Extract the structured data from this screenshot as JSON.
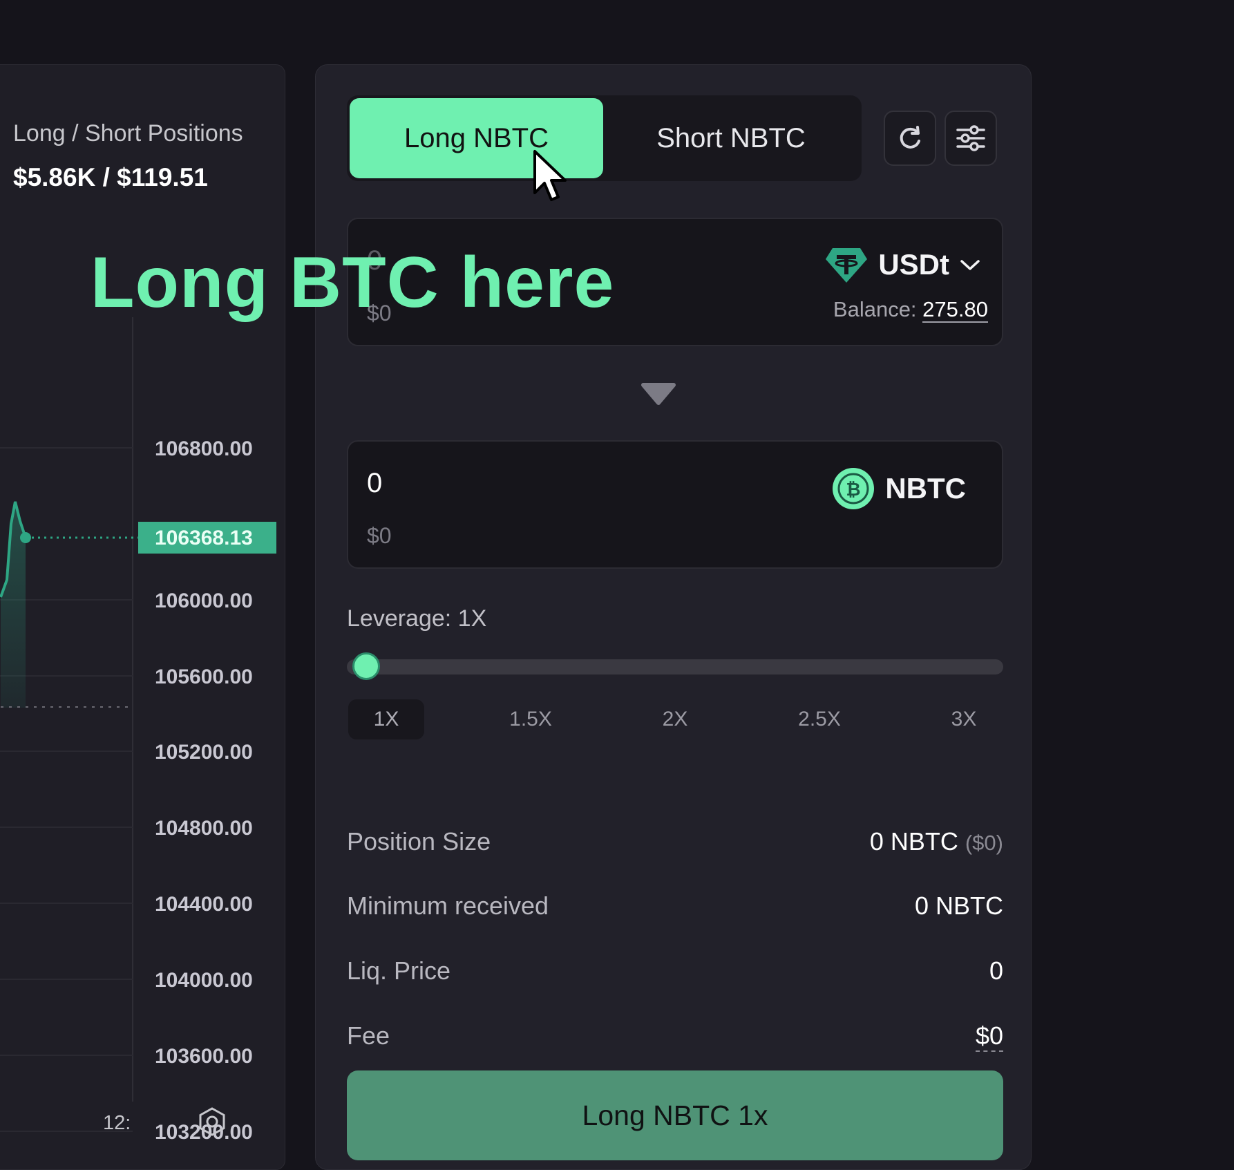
{
  "chart_panel": {
    "positions_label": "Long / Short Positions",
    "positions_value": "$5.86K / $119.51",
    "price_ticks": [
      "106800.00",
      "106000.00",
      "105600.00",
      "105200.00",
      "104800.00",
      "104400.00",
      "104000.00",
      "103600.00",
      "103200.00"
    ],
    "current_price": "106368.13",
    "time_label": "12:",
    "accent_color": "#2ea684"
  },
  "trade": {
    "tabs": {
      "long_label": "Long NBTC",
      "short_label": "Short NBTC",
      "active": "long"
    },
    "pay": {
      "amount": "0",
      "usd": "$0",
      "token": "USDt",
      "balance_label": "Balance:",
      "balance_value": "275.80"
    },
    "receive": {
      "amount": "0",
      "usd": "$0",
      "token": "NBTC"
    },
    "leverage": {
      "label": "Leverage: 1X",
      "options": [
        "1X",
        "1.5X",
        "2X",
        "2.5X",
        "3X"
      ],
      "selected": "1X",
      "level_fraction": 0
    },
    "info": {
      "position_size_label": "Position Size",
      "position_size_value": "0 NBTC",
      "position_size_usd": "($0)",
      "min_received_label": "Minimum received",
      "min_received_value": "0 NBTC",
      "liq_price_label": "Liq. Price",
      "liq_price_value": "0",
      "fee_label": "Fee",
      "fee_value": "$0"
    },
    "cta_label": "Long NBTC 1x",
    "accent_color": "#6ff0b0"
  },
  "overlay": {
    "caption": "Long BTC here"
  },
  "icons": [
    "refresh-icon",
    "sliders-icon",
    "tether-icon",
    "chevron-down-icon",
    "bitcoin-icon",
    "triangle-down-icon",
    "cursor-icon",
    "chart-settings-icon"
  ]
}
